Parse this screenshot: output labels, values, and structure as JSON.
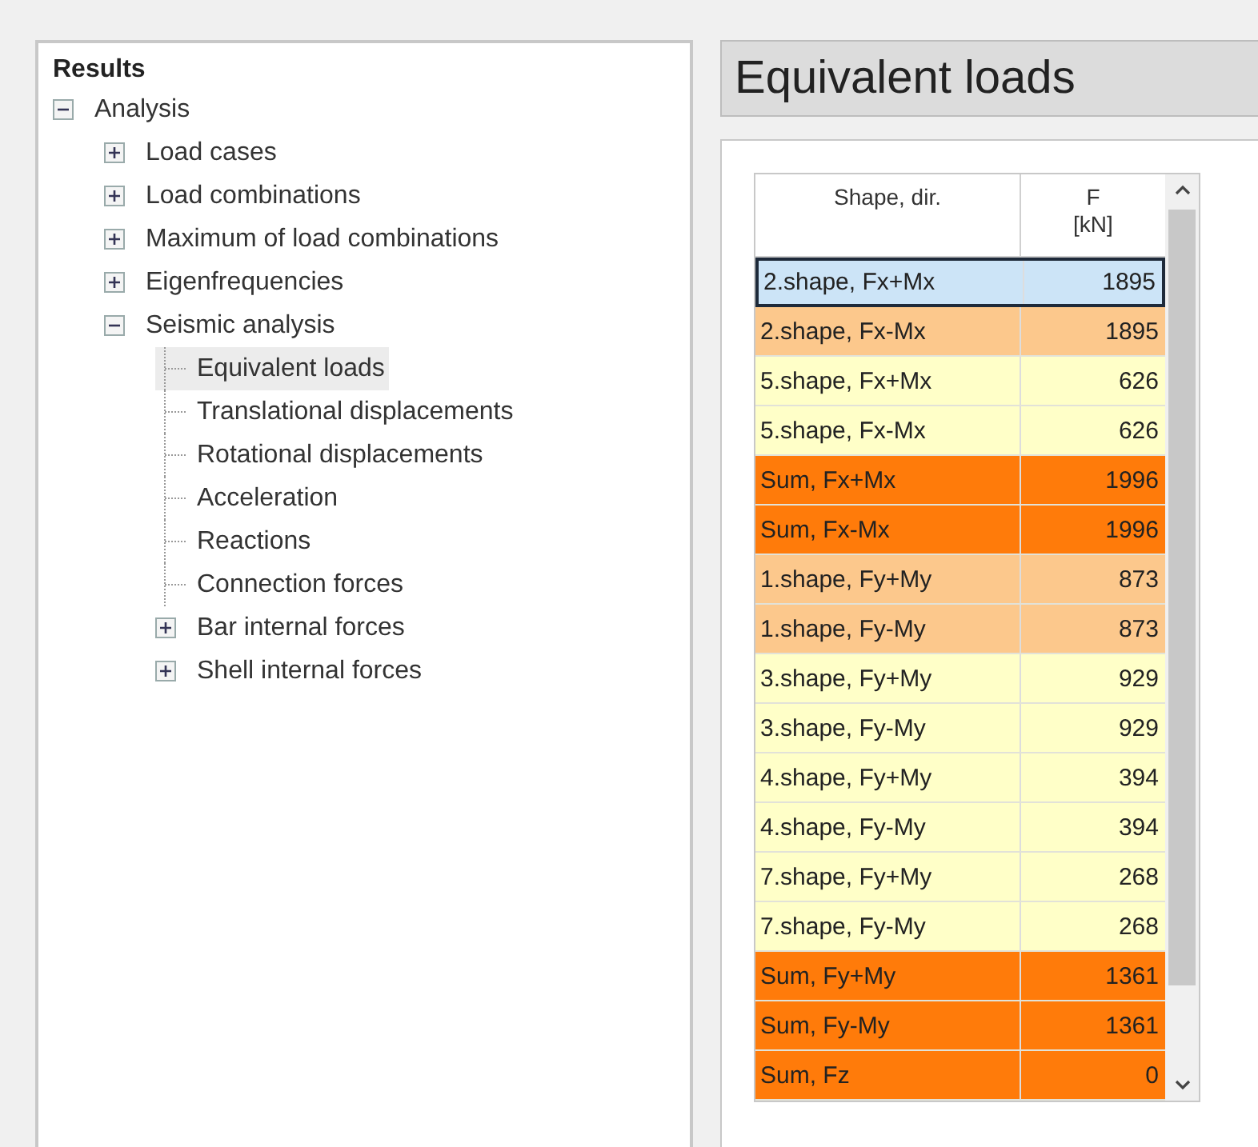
{
  "tree": {
    "title": "Results",
    "items": [
      {
        "label": "Analysis",
        "expanded": true,
        "selected": false,
        "children": [
          {
            "label": "Load cases",
            "expanded": false,
            "selected": false
          },
          {
            "label": "Load combinations",
            "expanded": false,
            "selected": false
          },
          {
            "label": "Maximum of load combinations",
            "expanded": false,
            "selected": false
          },
          {
            "label": "Eigenfrequencies",
            "expanded": false,
            "selected": false
          },
          {
            "label": "Seismic analysis",
            "expanded": true,
            "selected": false,
            "children": [
              {
                "label": "Equivalent loads",
                "selected": true
              },
              {
                "label": "Translational displacements",
                "selected": false
              },
              {
                "label": "Rotational displacements",
                "selected": false
              },
              {
                "label": "Acceleration",
                "selected": false
              },
              {
                "label": "Reactions",
                "selected": false
              },
              {
                "label": "Connection forces",
                "selected": false
              },
              {
                "label": "Bar internal forces",
                "expanded": false,
                "selected": false
              },
              {
                "label": "Shell internal forces",
                "expanded": false,
                "selected": false
              }
            ]
          }
        ]
      }
    ]
  },
  "panel": {
    "title": "Equivalent loads"
  },
  "table": {
    "columns": [
      {
        "label": "Shape, dir."
      },
      {
        "label": "F",
        "unit": "[kN]"
      }
    ],
    "rows": [
      {
        "shape": "2.shape, Fx+Mx",
        "f": "1895",
        "color": "#cce4f7",
        "selected": true
      },
      {
        "shape": "2.shape, Fx-Mx",
        "f": "1895",
        "color": "#fcc88c",
        "selected": false
      },
      {
        "shape": "5.shape, Fx+Mx",
        "f": "626",
        "color": "#ffffc8",
        "selected": false
      },
      {
        "shape": "5.shape, Fx-Mx",
        "f": "626",
        "color": "#ffffc8",
        "selected": false
      },
      {
        "shape": "Sum, Fx+Mx",
        "f": "1996",
        "color": "#ff7b0a",
        "selected": false
      },
      {
        "shape": "Sum, Fx-Mx",
        "f": "1996",
        "color": "#ff7b0a",
        "selected": false
      },
      {
        "shape": "1.shape, Fy+My",
        "f": "873",
        "color": "#fcc88c",
        "selected": false
      },
      {
        "shape": "1.shape, Fy-My",
        "f": "873",
        "color": "#fcc88c",
        "selected": false
      },
      {
        "shape": "3.shape, Fy+My",
        "f": "929",
        "color": "#ffffc8",
        "selected": false
      },
      {
        "shape": "3.shape, Fy-My",
        "f": "929",
        "color": "#ffffc8",
        "selected": false
      },
      {
        "shape": "4.shape, Fy+My",
        "f": "394",
        "color": "#ffffc8",
        "selected": false
      },
      {
        "shape": "4.shape, Fy-My",
        "f": "394",
        "color": "#ffffc8",
        "selected": false
      },
      {
        "shape": "7.shape, Fy+My",
        "f": "268",
        "color": "#ffffc8",
        "selected": false
      },
      {
        "shape": "7.shape, Fy-My",
        "f": "268",
        "color": "#ffffc8",
        "selected": false
      },
      {
        "shape": "Sum, Fy+My",
        "f": "1361",
        "color": "#ff7b0a",
        "selected": false
      },
      {
        "shape": "Sum, Fy-My",
        "f": "1361",
        "color": "#ff7b0a",
        "selected": false
      },
      {
        "shape": "Sum, Fz",
        "f": "0",
        "color": "#ff7b0a",
        "selected": false
      }
    ]
  }
}
